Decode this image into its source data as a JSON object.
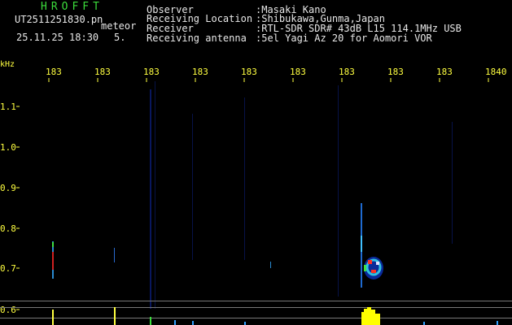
{
  "header": {
    "brand": "HROFFT",
    "filename": "UT2511251830.pn",
    "mode": "meteor",
    "datetime": "25.11.25 18:30",
    "index": "5.",
    "info": [
      {
        "label": "Observer",
        "value": ":Masaki Kano"
      },
      {
        "label": "Receiving Location",
        "value": ":Shibukawa,Gunma,Japan"
      },
      {
        "label": "Receiver",
        "value": ":RTL-SDR SDR# 43dB L15 114.1MHz USB"
      },
      {
        "label": "Receiving antenna",
        "value": ":5el Yagi Az 20 for Aomori VOR"
      }
    ]
  },
  "axes": {
    "y_unit": "kHz",
    "x_ticks": [
      "183",
      "183",
      "183",
      "183",
      "183",
      "183",
      "183",
      "183",
      "183",
      "1840"
    ],
    "y_ticks": [
      "1.1",
      "1.0",
      "0.9",
      "0.8",
      "0.7",
      "0.6"
    ]
  },
  "colors": {
    "background": "#000000",
    "text": "#e8e8e8",
    "axis_text": "#ffff40",
    "brand": "#3cdc3c",
    "meteor_echo": "#ffff00"
  }
}
